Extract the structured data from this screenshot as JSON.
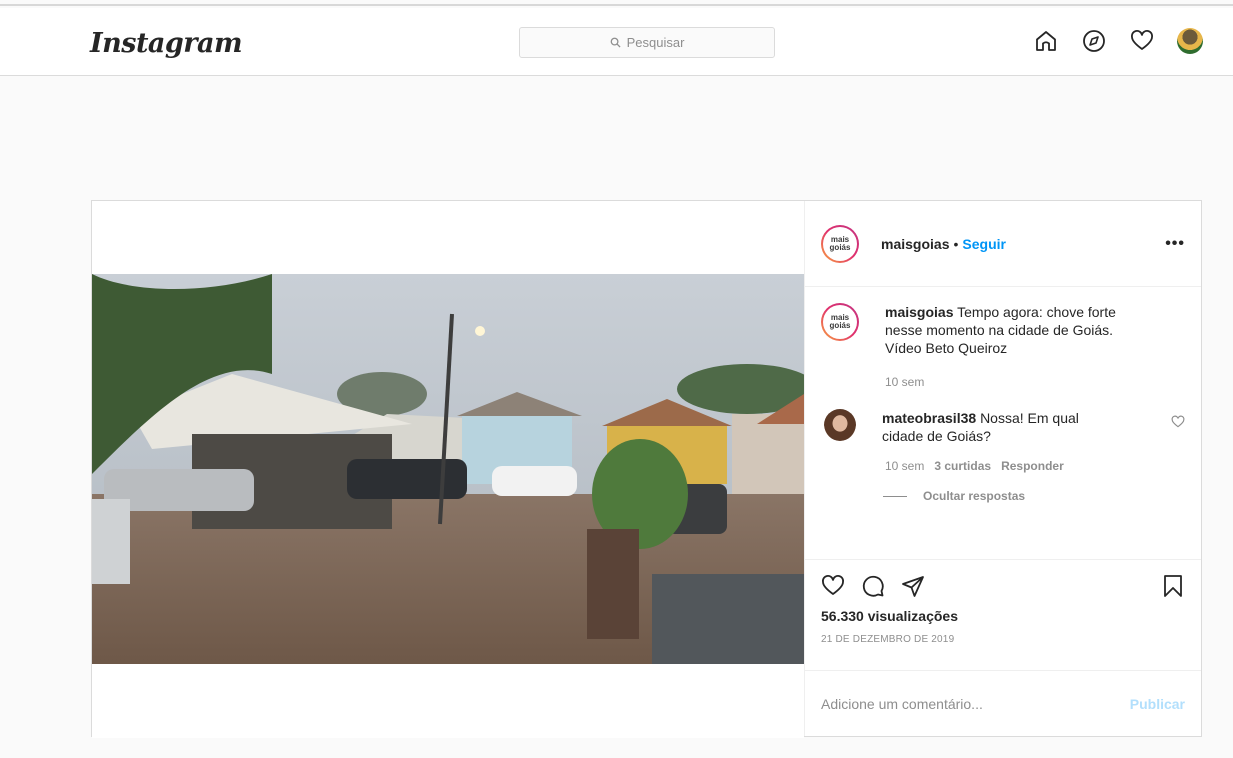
{
  "app": {
    "logo_text": "Instagram"
  },
  "search": {
    "placeholder": "Pesquisar"
  },
  "nav": {
    "icons": [
      "home-icon",
      "explore-icon",
      "activity-heart-icon",
      "profile-avatar"
    ]
  },
  "post": {
    "author": "maisgoias",
    "separator": "•",
    "follow_label": "Seguir",
    "more_label": "•••",
    "avatar_logo_text": [
      "mais",
      "goiás"
    ],
    "caption": {
      "username": "maisgoias",
      "text": "Tempo agora: chove forte nesse momento na cidade de Goiás. Vídeo Beto Queiroz",
      "time": "10 sem"
    },
    "comments": [
      {
        "username": "mateobrasil38",
        "text": "Nossa! Em qual cidade de Goiás?",
        "time": "10 sem",
        "likes": "3 curtidas",
        "reply_label": "Responder"
      }
    ],
    "hide_replies_label": "Ocultar respostas",
    "views": "56.330 visualizações",
    "date": "21 DE DEZEMBRO DE 2019",
    "add_comment_placeholder": "Adicione um comentário...",
    "publish_label": "Publicar"
  },
  "colors": {
    "accent": "#0095f6",
    "publish_disabled": "#b2dffc",
    "border": "#dbdbdb",
    "bg": "#fafafa"
  }
}
